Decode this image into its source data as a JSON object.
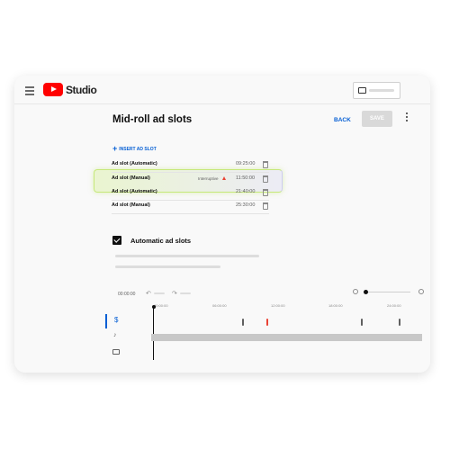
{
  "header": {
    "app_name": "Studio"
  },
  "page": {
    "title": "Mid-roll ad slots",
    "back_label": "BACK",
    "save_label": "SAVE",
    "more_icon": "more-vert-icon"
  },
  "insert": {
    "icon": "+",
    "label": "INSERT AD SLOT"
  },
  "ad_slots": [
    {
      "label": "Ad slot (Automatic)",
      "tag": "",
      "time": "09:25:00"
    },
    {
      "label": "Ad slot (Manual)",
      "tag": "Interruptive",
      "time": "11:50:00"
    },
    {
      "label": "Ad slot (Automatic)",
      "tag": "",
      "time": "21:40:00"
    },
    {
      "label": "Ad slot (Manual)",
      "tag": "",
      "time": "25:30:00"
    }
  ],
  "automatic": {
    "label": "Automatic ad slots",
    "checked": true
  },
  "timeline": {
    "current_time": "00:00:00",
    "ticks": [
      "00:00:00",
      "06:00:00",
      "12:00:00",
      "18:00:00",
      "24:00:00"
    ]
  },
  "colors": {
    "brand": "#ff0000",
    "link": "#065fd4",
    "highlight": "#c6e87a",
    "warning": "#ea4335"
  }
}
